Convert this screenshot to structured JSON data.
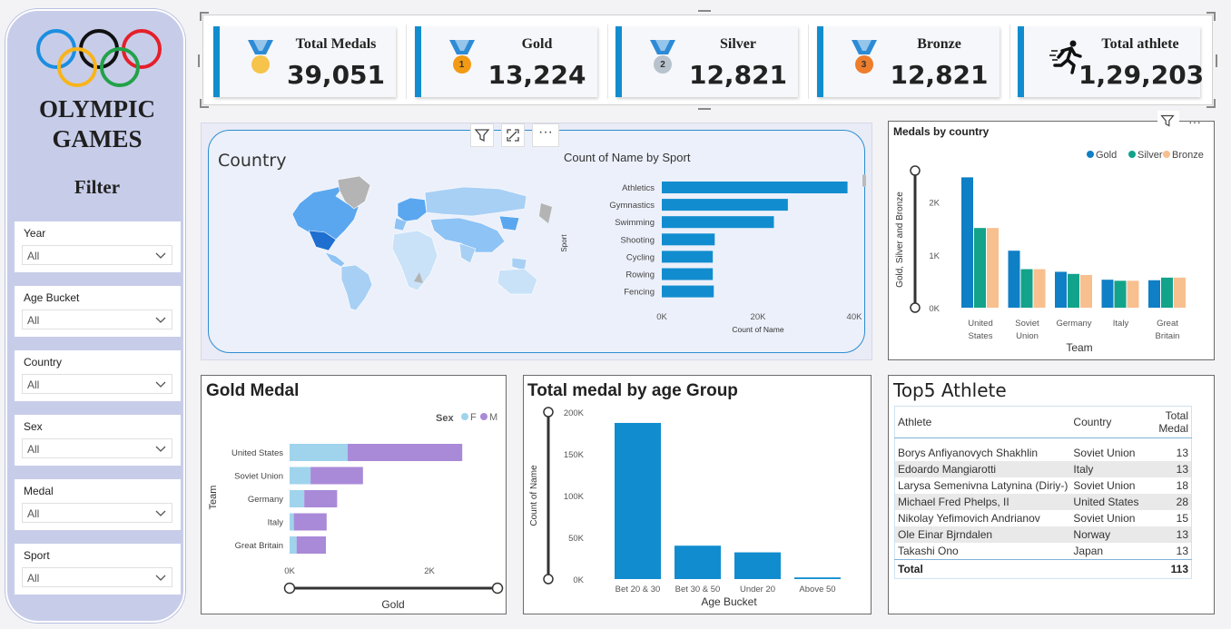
{
  "sidebar": {
    "title_line1": "OLYMPIC",
    "title_line2": "GAMES",
    "filter_label": "Filter",
    "ring_colors": [
      "#1b8ee0",
      "#111111",
      "#e5202a",
      "#f8b41a",
      "#22a249"
    ],
    "slicers": [
      {
        "label": "Year",
        "value": "All"
      },
      {
        "label": "Age Bucket",
        "value": "All"
      },
      {
        "label": "Country",
        "value": "All"
      },
      {
        "label": "Sex",
        "value": "All"
      },
      {
        "label": "Medal",
        "value": "All"
      },
      {
        "label": "Sport",
        "value": "All"
      }
    ]
  },
  "kpis": [
    {
      "label": "Total Medals",
      "value": "39,051",
      "icon": "medal-icon"
    },
    {
      "label": "Gold",
      "value": "13,224",
      "icon": "gold-medal-icon",
      "badge": "1"
    },
    {
      "label": "Silver",
      "value": "12,821",
      "icon": "silver-medal-icon",
      "badge": "2"
    },
    {
      "label": "Bronze",
      "value": "12,821",
      "icon": "bronze-medal-icon",
      "badge": "3"
    },
    {
      "label": "Total athlete",
      "value": "1,29,203",
      "icon": "runner-icon"
    }
  ],
  "colors": {
    "accent": "#118dcf",
    "gold": "#0f7fc6",
    "silver": "#12a38a",
    "bronze": "#f8bf8f",
    "female": "#9fd4ec",
    "male": "#a98ad8"
  },
  "country_panel": {
    "title": "Country"
  },
  "sport_chart": {
    "chart_data": {
      "type": "bar",
      "title": "Count of Name by Sport",
      "ylabel": "Sport",
      "xlabel": "Count of Name",
      "categories": [
        "Athletics",
        "Gymnastics",
        "Swimming",
        "Shooting",
        "Cycling",
        "Rowing",
        "Fencing"
      ],
      "values": [
        38600,
        26200,
        23300,
        11000,
        10600,
        10600,
        10800
      ],
      "xlim": [
        0,
        40000
      ],
      "x_ticks": [
        "0K",
        "20K",
        "40K"
      ]
    }
  },
  "country_medals": {
    "chart_data": {
      "type": "bar",
      "title": "Medals by country",
      "xlabel": "Team",
      "ylabel": "Gold, Silver and Bronze",
      "categories": [
        "United States",
        "Soviet Union",
        "Germany",
        "Italy",
        "Great Britain"
      ],
      "series": [
        {
          "name": "Gold",
          "values": [
            2470,
            1080,
            680,
            530,
            520
          ]
        },
        {
          "name": "Silver",
          "values": [
            1510,
            730,
            640,
            510,
            570
          ]
        },
        {
          "name": "Bronze",
          "values": [
            1510,
            730,
            620,
            510,
            570
          ]
        }
      ],
      "ylim": [
        0,
        2700
      ],
      "y_ticks": [
        "0K",
        "1K",
        "2K"
      ],
      "legend": "top-right"
    }
  },
  "gold_medal": {
    "chart_data": {
      "type": "bar",
      "title": "Gold Medal",
      "xlabel": "Gold",
      "ylabel": "Team",
      "legend_title": "Sex",
      "categories": [
        "United States",
        "Soviet Union",
        "Germany",
        "Italy",
        "Great Britain"
      ],
      "series": [
        {
          "name": "F",
          "values": [
            830,
            300,
            210,
            60,
            100
          ]
        },
        {
          "name": "M",
          "values": [
            1640,
            750,
            470,
            470,
            420
          ]
        }
      ],
      "xlim": [
        0,
        3000
      ],
      "x_ticks": [
        "0K",
        "2K"
      ]
    }
  },
  "age_group": {
    "chart_data": {
      "type": "bar",
      "title": "Total medal by age Group",
      "xlabel": "Age Bucket",
      "ylabel": "Count of Name",
      "categories": [
        "Bet 20 & 30",
        "Bet 30 & 50",
        "Under 20",
        "Above 50"
      ],
      "values": [
        187000,
        40000,
        32000,
        2000
      ],
      "ylim": [
        0,
        200000
      ],
      "y_ticks": [
        "0K",
        "50K",
        "100K",
        "150K",
        "200K"
      ]
    }
  },
  "top5": {
    "title": "Top5 Athlete",
    "columns": [
      "Athlete",
      "Country",
      "Total Medal"
    ],
    "rows": [
      [
        "Borys Anfiyanovych Shakhlin",
        "Soviet Union",
        "13"
      ],
      [
        "Edoardo Mangiarotti",
        "Italy",
        "13"
      ],
      [
        "Larysa Semenivna Latynina (Diriy-)",
        "Soviet Union",
        "18"
      ],
      [
        "Michael Fred Phelps, II",
        "United States",
        "28"
      ],
      [
        "Nikolay Yefimovich Andrianov",
        "Soviet Union",
        "15"
      ],
      [
        "Ole Einar Bjrndalen",
        "Norway",
        "13"
      ],
      [
        "Takashi Ono",
        "Japan",
        "13"
      ]
    ],
    "total_label": "Total",
    "total_value": "113"
  }
}
